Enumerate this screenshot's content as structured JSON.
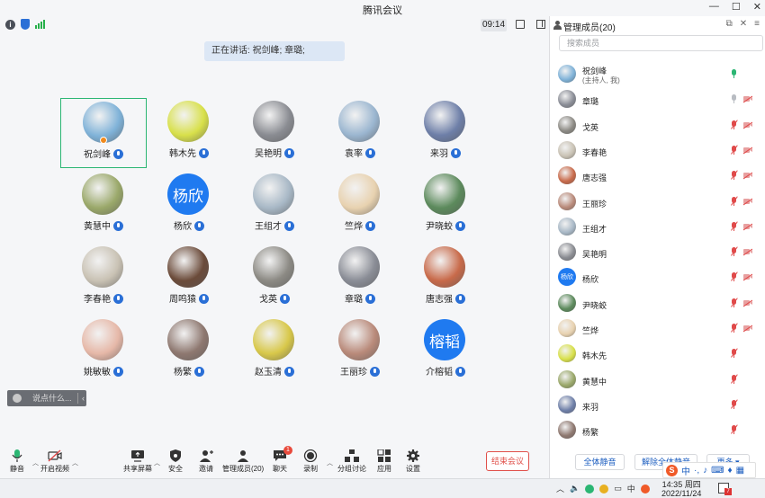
{
  "window": {
    "title": "腾讯会议",
    "controls": [
      "minimize-icon",
      "maximize-icon",
      "close-icon"
    ]
  },
  "meeting_bar": {
    "timer": "09:14",
    "icons": [
      "info-icon",
      "shield-icon",
      "signal-icon",
      "fullscreen-icon",
      "side-panel-icon"
    ]
  },
  "speaking": {
    "text": "正在讲话: 祝剑峰; 章璐;"
  },
  "participants": [
    {
      "name": "祝剑峰",
      "color": "#7fb2d8",
      "active": true,
      "host": true
    },
    {
      "name": "韩木先",
      "color": "#d8e04a"
    },
    {
      "name": "吴艳明",
      "color": "#8a8c92"
    },
    {
      "name": "袁率",
      "color": "#9bb6d0"
    },
    {
      "name": "来羽",
      "color": "#6e7fa8"
    },
    {
      "name": "黄慧中",
      "color": "#9aa86a"
    },
    {
      "name": "杨欣",
      "text_avatar": "杨欣"
    },
    {
      "name": "王组才",
      "color": "#a8b8c6"
    },
    {
      "name": "竺烨",
      "color": "#e8d2b0"
    },
    {
      "name": "尹晓蛟",
      "color": "#5c8a5c"
    },
    {
      "name": "李春艳",
      "color": "#c9c2b4"
    },
    {
      "name": "周鸣猿",
      "color": "#6b4b3a"
    },
    {
      "name": "戈英",
      "color": "#8c8a84"
    },
    {
      "name": "章璐",
      "color": "#8a8d96"
    },
    {
      "name": "唐志强",
      "color": "#c86a4a"
    },
    {
      "name": "姚敏敏",
      "color": "#e6b8a8"
    },
    {
      "name": "杨繁",
      "color": "#8e7870"
    },
    {
      "name": "赵玉清",
      "color": "#d8c84a"
    },
    {
      "name": "王丽珍",
      "color": "#b98a7a"
    },
    {
      "name": "介榕韬",
      "text_avatar": "榕韬"
    }
  ],
  "chat": {
    "placeholder": "说点什么..."
  },
  "toolbar": {
    "mute": "静音",
    "video": "开启视频",
    "share": "共享屏幕",
    "security": "安全",
    "invite": "邀请",
    "members": "管理成员(20)",
    "chat": "聊天",
    "chat_badge": "1",
    "record": "录制",
    "breakout": "分组讨论",
    "apps": "应用",
    "settings": "设置",
    "end": "结束会议"
  },
  "member_panel": {
    "title": "管理成员(20)",
    "search_placeholder": "搜索成员",
    "members": [
      {
        "name": "祝剑峰",
        "sub": "(主持人, 我)",
        "color": "#7fb2d8",
        "mic": "on"
      },
      {
        "name": "章璐",
        "color": "#8a8d96",
        "mic": "idle",
        "cam": "off"
      },
      {
        "name": "戈英",
        "color": "#8c8a84",
        "mic": "off",
        "cam": "off"
      },
      {
        "name": "李春艳",
        "color": "#c9c2b4",
        "mic": "off",
        "cam": "off"
      },
      {
        "name": "唐志强",
        "color": "#c86a4a",
        "mic": "off",
        "cam": "off"
      },
      {
        "name": "王丽珍",
        "color": "#b98a7a",
        "mic": "off",
        "cam": "off"
      },
      {
        "name": "王组才",
        "color": "#a8b8c6",
        "mic": "off",
        "cam": "off"
      },
      {
        "name": "吴艳明",
        "color": "#8a8c92",
        "mic": "off",
        "cam": "off"
      },
      {
        "name": "杨欣",
        "text_avatar": "杨欣",
        "mic": "off",
        "cam": "off"
      },
      {
        "name": "尹晓蛟",
        "color": "#5c8a5c",
        "mic": "off",
        "cam": "off"
      },
      {
        "name": "竺烨",
        "color": "#e8d2b0",
        "mic": "off",
        "cam": "off"
      },
      {
        "name": "韩木先",
        "color": "#d8e04a",
        "mic": "off"
      },
      {
        "name": "黄慧中",
        "color": "#9aa86a",
        "mic": "off"
      },
      {
        "name": "来羽",
        "color": "#6e7fa8",
        "mic": "off"
      },
      {
        "name": "杨繁",
        "color": "#8e7870",
        "mic": "off"
      }
    ],
    "mute_all": "全体静音",
    "unmute_all": "解除全体静音",
    "more": "更多"
  },
  "taskbar": {
    "ime_mode": "中",
    "time": "14:35 周四",
    "date": "2022/11/24",
    "notif_count": "7"
  }
}
